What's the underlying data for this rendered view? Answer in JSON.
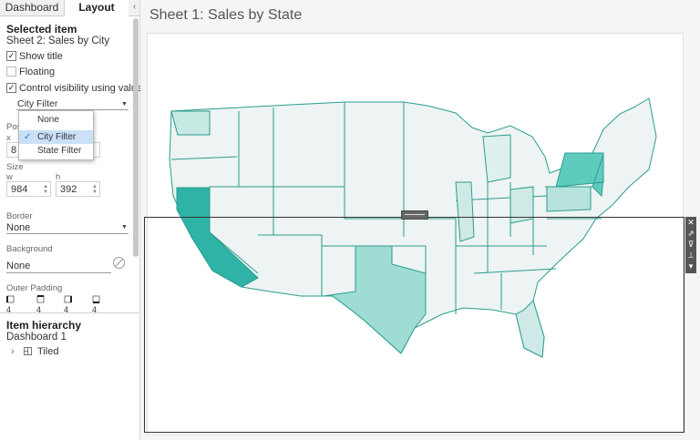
{
  "tabs": {
    "dashboard": "Dashboard",
    "layout": "Layout",
    "collapse": "‹"
  },
  "selected_item": {
    "heading": "Selected item",
    "name": "Sheet 2: Sales by City",
    "show_title": {
      "label": "Show title",
      "checked": "✓"
    },
    "floating": {
      "label": "Floating",
      "checked": ""
    },
    "control_visibility": {
      "label": "Control visibility using value",
      "checked": "✓"
    },
    "visibility_value": "City Filter"
  },
  "dropdown": {
    "options": [
      {
        "label": "None",
        "check": ""
      },
      {
        "label": "City Filter",
        "check": "✓"
      },
      {
        "label": "State Filter",
        "check": ""
      }
    ]
  },
  "position": {
    "label": "Pos",
    "x_label": "x",
    "x_value": "8"
  },
  "size": {
    "label": "Size",
    "w_label": "w",
    "h_label": "h",
    "w_value": "984",
    "h_value": "392"
  },
  "border": {
    "label": "Border",
    "value": "None"
  },
  "background": {
    "label": "Background",
    "value": "None"
  },
  "outer_padding": {
    "label": "Outer Padding",
    "values": [
      "4",
      "4",
      "4",
      "4"
    ]
  },
  "hierarchy": {
    "heading": "Item hierarchy",
    "root": "Dashboard 1",
    "child": "Tiled",
    "expander": "›"
  },
  "sheet": {
    "title": "Sheet 1: Sales by State"
  },
  "colors": {
    "accent": "#2a9d8f",
    "selection": "#c9e0f7",
    "dark_state": "#2fb3a6",
    "mid_state": "#5fcbbf"
  },
  "icons": [
    "chevron-left-icon",
    "checkbox-icon",
    "caret-down-icon",
    "no-color-icon",
    "padding-icon",
    "tiled-icon",
    "close-icon",
    "open-icon",
    "filter-icon",
    "pin-icon",
    "more-icon"
  ]
}
